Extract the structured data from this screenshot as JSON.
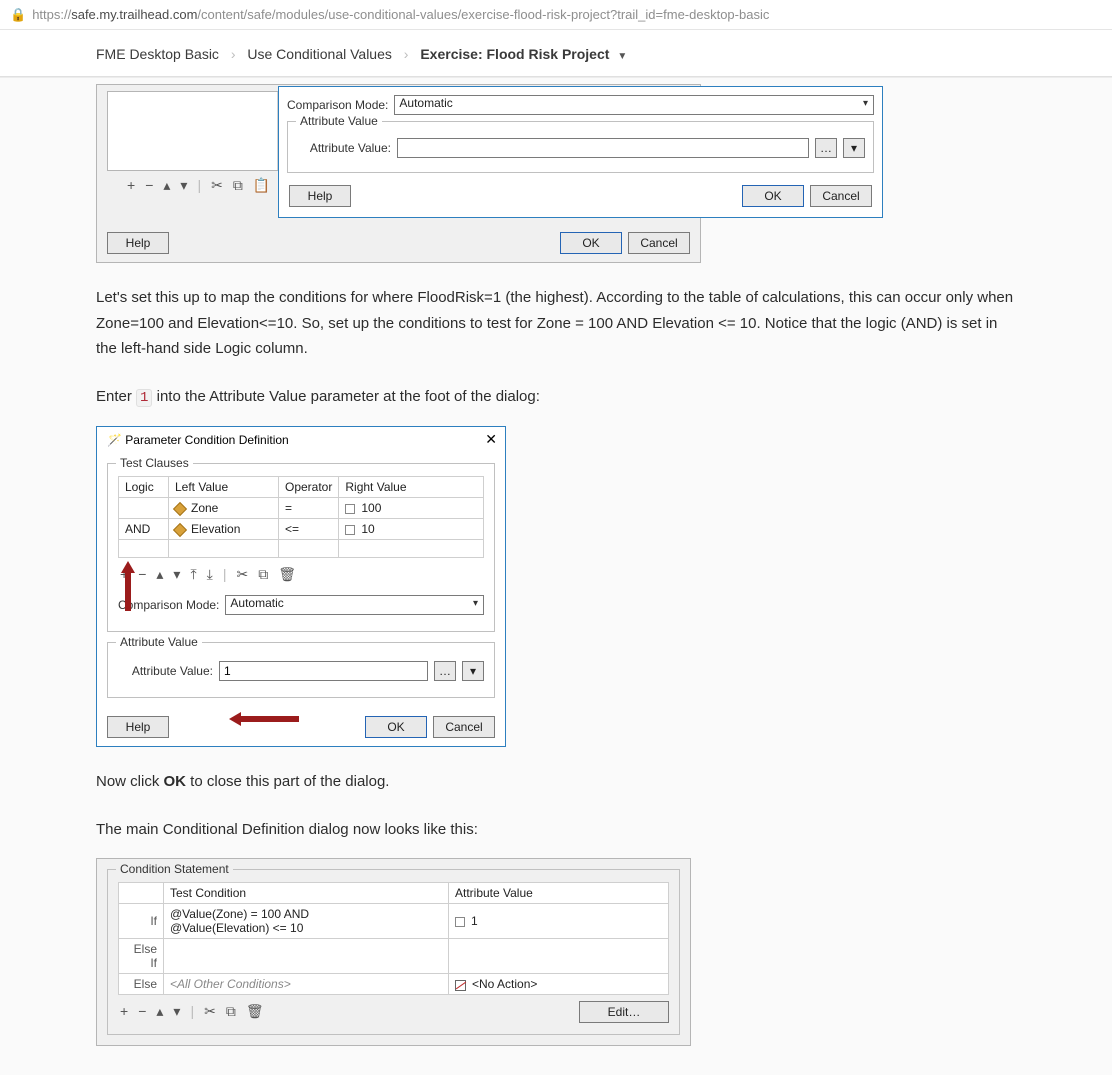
{
  "url": {
    "scheme": "https://",
    "host": "safe.my.trailhead.com",
    "path": "/content/safe/modules/use-conditional-values/exercise-flood-risk-project?trail_id=fme-desktop-basic"
  },
  "breadcrumbs": {
    "a": "FME Desktop Basic",
    "b": "Use Conditional Values",
    "c": "Exercise: Flood Risk Project"
  },
  "fig1": {
    "comparison_mode_label": "Comparison Mode:",
    "comparison_mode_value": "Automatic",
    "attr_value_group": "Attribute Value",
    "attr_value_label": "Attribute Value:",
    "help": "Help",
    "ok": "OK",
    "cancel": "Cancel"
  },
  "para1": "Let's set this up to map the conditions for where FloodRisk=1 (the highest). According to the table of calculations, this can occur only when Zone=100 and Elevation<=10. So, set up the conditions to test for Zone = 100 AND Elevation <= 10. Notice that the logic (AND) is set in the left-hand side Logic column.",
  "para2_a": "Enter ",
  "para2_code": "1",
  "para2_b": " into the Attribute Value parameter at the foot of the dialog:",
  "fig2": {
    "title": "Parameter Condition Definition",
    "wizard_icon": "wizard-icon",
    "group_test": "Test Clauses",
    "headers": {
      "logic": "Logic",
      "left": "Left Value",
      "op": "Operator",
      "right": "Right Value"
    },
    "rows": [
      {
        "logic": "",
        "left": "Zone",
        "op": "=",
        "right": "100"
      },
      {
        "logic": "AND",
        "left": "Elevation",
        "op": "<=",
        "right": "10"
      }
    ],
    "comparison_mode_label": "Comparison Mode:",
    "comparison_mode_value": "Automatic",
    "attr_value_group": "Attribute Value",
    "attr_value_label": "Attribute Value:",
    "attr_value_value": "1",
    "help": "Help",
    "ok": "OK",
    "cancel": "Cancel"
  },
  "para3_a": "Now click ",
  "para3_b": "OK",
  "para3_c": " to close this part of the dialog.",
  "para4": "The main Conditional Definition dialog now looks like this:",
  "fig3": {
    "group": "Condition Statement",
    "headers": {
      "cond": "Test Condition",
      "val": "Attribute Value"
    },
    "row_if_label": "If",
    "row_if_cond_a": "@Value(Zone) = 100 AND",
    "row_if_cond_b": "@Value(Elevation) <= 10",
    "row_if_val": "1",
    "row_elseif_label": "Else If",
    "row_else_label": "Else",
    "row_else_cond": "<All Other Conditions>",
    "row_else_val": "<No Action>",
    "edit": "Edit…"
  },
  "toolbar_glyphs": {
    "plus": "+",
    "minus": "−",
    "up": "▴",
    "down": "▾",
    "top": "⤒",
    "bottom": "⤓",
    "sep": "|",
    "cut": "✂",
    "copy": "⧉",
    "paste": "📋",
    "trash": "🗑",
    "ellipsis": "…",
    "drop": "▾"
  }
}
